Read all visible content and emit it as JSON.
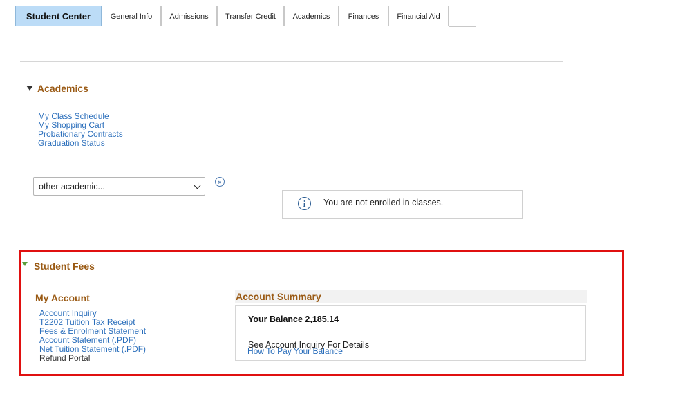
{
  "tabs": [
    {
      "label": "Student Center",
      "active": true
    },
    {
      "label": "General Info"
    },
    {
      "label": "Admissions"
    },
    {
      "label": "Transfer Credit"
    },
    {
      "label": "Academics"
    },
    {
      "label": "Finances"
    },
    {
      "label": "Financial Aid"
    }
  ],
  "academics": {
    "title": "Academics",
    "links": [
      "My Class Schedule",
      "My Shopping Cart",
      "Probationary Contracts",
      "Graduation Status"
    ],
    "select_value": "other academic...",
    "notice": "You are not enrolled in classes."
  },
  "student_fees": {
    "title": "Student Fees",
    "my_account": {
      "title": "My Account",
      "links": [
        "Account Inquiry",
        "T2202 Tuition Tax Receipt",
        "Fees & Enrolment Statement",
        "Account Statement (.PDF)",
        "Net Tuition Statement (.PDF)"
      ],
      "refund": "Refund Portal"
    },
    "summary": {
      "title": "Account Summary",
      "balance": "Your Balance 2,185.14",
      "details": "See Account Inquiry For Details",
      "how_to_pay": "How To Pay Your Balance"
    }
  },
  "colors": {
    "accent": "#9a5a14",
    "link": "#2a6ebb",
    "active_tab": "#bcdcf7",
    "highlight": "#e01010"
  }
}
